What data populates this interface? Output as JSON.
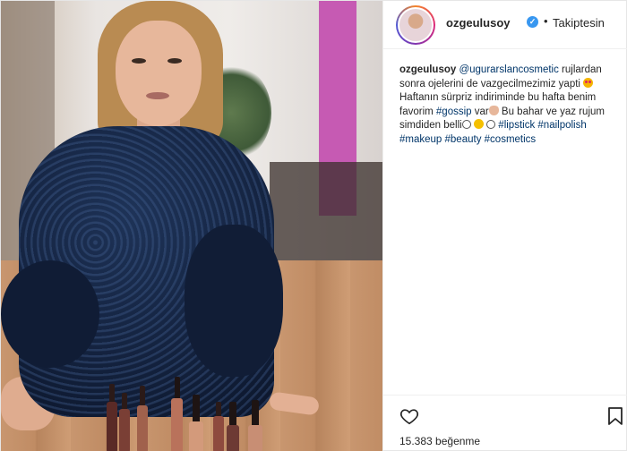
{
  "post": {
    "username": "ozgeulusoy",
    "follow_separator": "•",
    "follow_label": "Takiptesin",
    "caption": {
      "author": "ozgeulusoy",
      "mention": "@ugurarslancosmetic",
      "text1": " rujlardan sonra ojelerini de vazgecilmezimiz yapti",
      "text2": "Haftanın sürpriz indiriminde bu hafta benim favorim ",
      "tag_gossip": "#gossip",
      "text3": " var",
      "text4": "Bu bahar ve yaz rujum simdiden belli",
      "tag_lipstick": "#lipstick",
      "tag_nailpolish": "#nailpolish",
      "tag_makeup": "#makeup",
      "tag_beauty": "#beauty",
      "tag_cosmetics": "#cosmetics"
    },
    "likes_count": "15.383",
    "likes_label": "beğenme"
  },
  "icons": {
    "verified": "verified-badge-icon",
    "like": "heart-icon",
    "save": "bookmark-icon"
  },
  "colors": {
    "link": "#003569",
    "verified": "#3897f0",
    "text": "#262626"
  }
}
